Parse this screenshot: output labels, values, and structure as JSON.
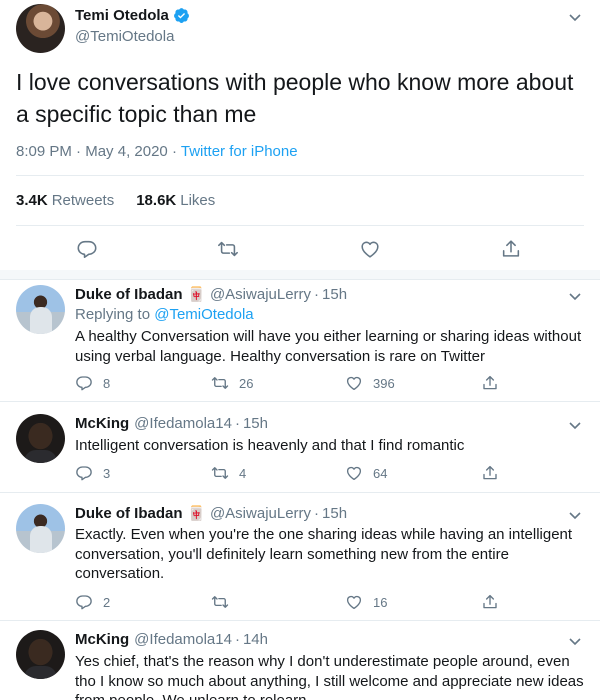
{
  "main_tweet": {
    "author_name": "Temi Otedola",
    "handle": "@TemiOtedola",
    "text": "I love conversations with people who know more about a specific topic than me",
    "time": "8:09 PM",
    "dot": "·",
    "date": "May 4, 2020",
    "source": "Twitter for iPhone",
    "retweets_count": "3.4K",
    "retweets_label": "Retweets",
    "likes_count": "18.6K",
    "likes_label": "Likes"
  },
  "replies": [
    {
      "name": "Duke of Ibadan",
      "emoji": "🀄",
      "handle": "@AsiwajuLerry",
      "dot": "·",
      "time": "15h",
      "replying_prefix": "Replying to",
      "replying_to": "@TemiOtedola",
      "text": "A healthy Conversation will have you either learning or sharing ideas without using verbal language. Healthy conversation is rare on Twitter",
      "replies": "8",
      "retweets": "26",
      "likes": "396"
    },
    {
      "name": "McKing",
      "handle": "@Ifedamola14",
      "dot": "·",
      "time": "15h",
      "text": "Intelligent conversation is heavenly and that I find romantic",
      "replies": "3",
      "retweets": "4",
      "likes": "64"
    },
    {
      "name": "Duke of Ibadan",
      "emoji": "🀄",
      "handle": "@AsiwajuLerry",
      "dot": "·",
      "time": "15h",
      "text": "Exactly. Even when you're the one sharing ideas while having an intelligent conversation, you'll definitely learn something new from the entire conversation.",
      "replies": "2",
      "retweets": "",
      "likes": "16"
    },
    {
      "name": "McKing",
      "handle": "@Ifedamola14",
      "dot": "·",
      "time": "14h",
      "text": "Yes chief, that's the reason why I don't underestimate people around, even tho I know so much about anything, I still welcome and appreciate new ideas from people. We unlearn to relearn"
    }
  ],
  "icons": {
    "verified": "verified-badge-icon",
    "chevron": "chevron-down-icon",
    "reply": "reply-icon",
    "retweet": "retweet-icon",
    "like": "heart-icon",
    "share": "share-icon"
  },
  "colors": {
    "accent": "#1da1f2",
    "secondary_text": "#657786",
    "divider": "#e6ecf0"
  }
}
